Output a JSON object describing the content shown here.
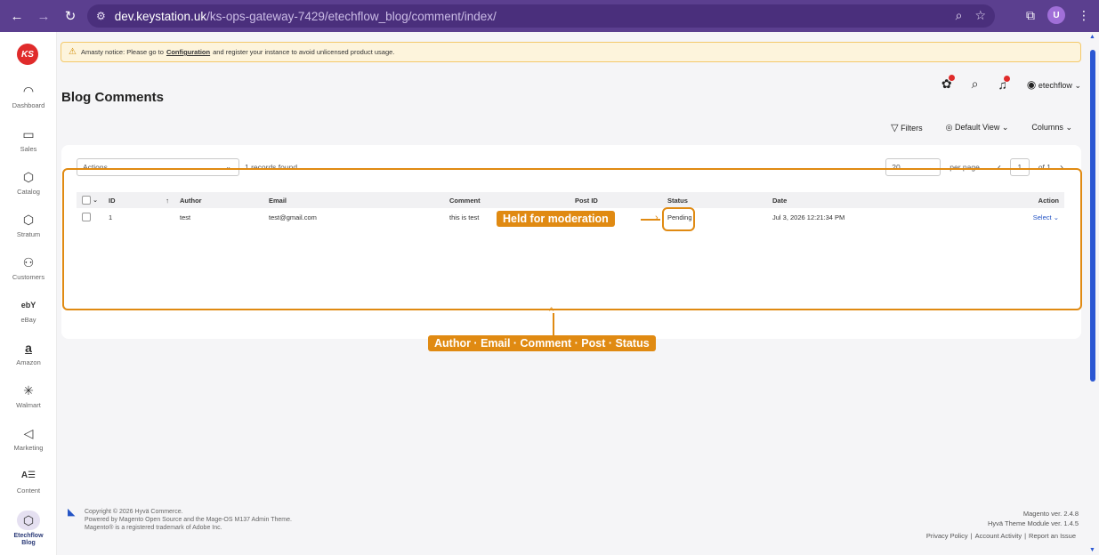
{
  "browser": {
    "url_host": "dev.keystation.uk",
    "url_path": "/ks-ops-gateway-7429/etechflow_blog/comment/index/",
    "profile_initial": "U"
  },
  "sidebar": {
    "logo": "KS",
    "items": [
      {
        "label": "Dashboard",
        "icon": "⌚"
      },
      {
        "label": "Sales",
        "icon": "▭"
      },
      {
        "label": "Catalog",
        "icon": "⬡"
      },
      {
        "label": "Stratum",
        "icon": "⬡"
      },
      {
        "label": "Customers",
        "icon": "⚇"
      },
      {
        "label": "eBay",
        "icon": "ebY"
      },
      {
        "label": "Amazon",
        "icon": "a"
      },
      {
        "label": "Walmart",
        "icon": "✳"
      },
      {
        "label": "Marketing",
        "icon": "◁"
      },
      {
        "label": "Content",
        "icon": "A☰"
      },
      {
        "label": "Etechflow Blog",
        "icon": "⬡"
      }
    ]
  },
  "notice": {
    "prefix": "Amasty notice: Please go to",
    "link": "Configuration",
    "suffix": "and register your instance to avoid unlicensed product usage."
  },
  "page": {
    "title": "Blog Comments"
  },
  "header": {
    "user": "etechflow"
  },
  "toolbar": {
    "filters": "Filters",
    "view": "Default View",
    "columns": "Columns"
  },
  "grid": {
    "actions_label": "Actions",
    "records_found": "1 records found",
    "per_page_value": "20",
    "per_page_label": "per page",
    "page_current": "1",
    "page_total": "of 1",
    "columns": [
      "ID",
      "Author",
      "Email",
      "Comment",
      "Post ID",
      "Status",
      "Date",
      "Action"
    ],
    "rows": [
      {
        "id": "1",
        "author": "test",
        "email": "test@gmail.com",
        "comment": "this is test",
        "post_id": "",
        "status": "Pending",
        "date": "Jul 3, 2026 12:21:34 PM",
        "action": "Select"
      }
    ]
  },
  "annotations": {
    "status_note": "Held for moderation",
    "columns_note": "Author · Email · Comment · Post · Status"
  },
  "footer": {
    "line1": "Copyright © 2026 Hyvä Commerce.",
    "line2": "Powered by Magento Open Source and the Mage-OS M137 Admin Theme.",
    "line3": "Magento® is a registered trademark of Adobe Inc.",
    "magento_ver": "Magento ver. 2.4.8",
    "hyva_ver": "Hyvä Theme Module ver. 1.4.5",
    "privacy": "Privacy Policy",
    "activity": "Account Activity",
    "report": "Report an Issue"
  },
  "colors": {
    "chrome": "#5b3f8f",
    "annotation": "#e08a12",
    "link": "#2454c5"
  }
}
